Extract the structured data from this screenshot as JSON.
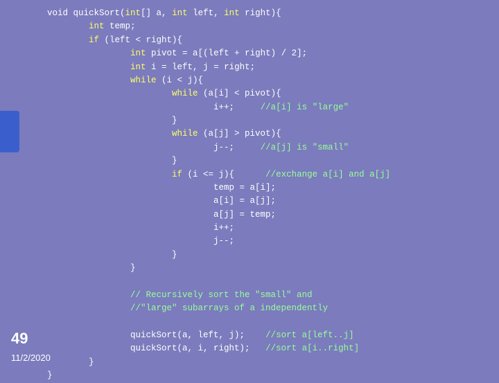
{
  "slide": {
    "number": "49",
    "date": "11/2/2020",
    "background_color": "#7b7bbd"
  },
  "code": {
    "lines": [
      {
        "text": "void quickSort(int[] a, int left, int right){",
        "type": "normal"
      },
      {
        "text": "        int temp;",
        "type": "normal"
      },
      {
        "text": "        if (left < right){",
        "type": "normal"
      },
      {
        "text": "                int pivot = a[(left + right) / 2];",
        "type": "normal"
      },
      {
        "text": "                int i = left, j = right;",
        "type": "normal"
      },
      {
        "text": "                while (i < j){",
        "type": "normal"
      },
      {
        "text": "                        while (a[i] < pivot){",
        "type": "normal"
      },
      {
        "text": "                                i++;     //a[i] is \"large\"",
        "type": "normal"
      },
      {
        "text": "                        }",
        "type": "normal"
      },
      {
        "text": "                        while (a[j] > pivot){",
        "type": "normal"
      },
      {
        "text": "                                j--;     //a[j] is \"small\"",
        "type": "normal"
      },
      {
        "text": "                        }",
        "type": "normal"
      },
      {
        "text": "                        if (i <= j){      //exchange a[i] and a[j]",
        "type": "normal"
      },
      {
        "text": "                                temp = a[i];",
        "type": "normal"
      },
      {
        "text": "                                a[i] = a[j];",
        "type": "normal"
      },
      {
        "text": "                                a[j] = temp;",
        "type": "normal"
      },
      {
        "text": "                                i++;",
        "type": "normal"
      },
      {
        "text": "                                j--;",
        "type": "normal"
      },
      {
        "text": "                        }",
        "type": "normal"
      },
      {
        "text": "                }",
        "type": "normal"
      },
      {
        "text": "",
        "type": "normal"
      },
      {
        "text": "                // Recursively sort the \"small\" and",
        "type": "comment"
      },
      {
        "text": "                //\"large\" subarrays of a independently",
        "type": "comment"
      },
      {
        "text": "",
        "type": "normal"
      },
      {
        "text": "                quickSort(a, left, j);    //sort a[left..j]",
        "type": "normal"
      },
      {
        "text": "                quickSort(a, i, right);   //sort a[i..right]",
        "type": "normal"
      },
      {
        "text": "        }",
        "type": "normal"
      },
      {
        "text": "}",
        "type": "normal"
      }
    ]
  }
}
